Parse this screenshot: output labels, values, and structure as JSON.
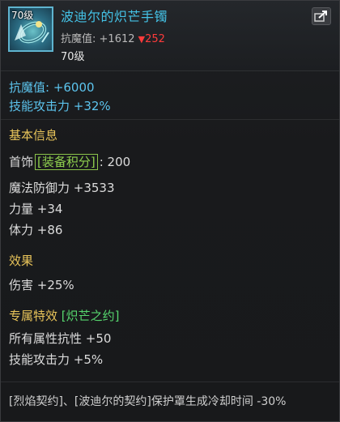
{
  "item": {
    "level_badge": "70级",
    "name": "波迪尔的炽芒手镯",
    "magic_label": "抗魔值:",
    "magic_value": "+1612",
    "magic_triangle": "▼",
    "magic_delta": "252",
    "required_level": "70级"
  },
  "base": {
    "anti_magic": "抗魔值: +6000",
    "skill_attack": "技能攻击力 +32%"
  },
  "basic_info": {
    "title": "基本信息",
    "slot": "首饰",
    "score_tag": "[装备积分]",
    "score_value": ": 200",
    "stats": [
      "魔法防御力 +3533",
      "力量 +34",
      "体力 +86"
    ]
  },
  "effect": {
    "title": "效果",
    "lines": [
      "伤害 +25%"
    ]
  },
  "exclusive": {
    "title": "专属特效",
    "tag": "[炽芒之约]",
    "lines": [
      "所有属性抗性 +50",
      "技能攻击力 +5%"
    ]
  },
  "set_bonus": {
    "text": "[烈焰契约]、[波迪尔的契约]保护罩生成冷却时间 -30%"
  },
  "colors": {
    "name_blue": "#44c2e6",
    "stat_blue": "#5cc4ee",
    "section_gold": "#e8c45a",
    "tag_green": "#56d66e",
    "delta_red": "#ff3b3b"
  },
  "icons": {
    "item": "bracelet-icon",
    "share": "share-arrow-icon"
  }
}
